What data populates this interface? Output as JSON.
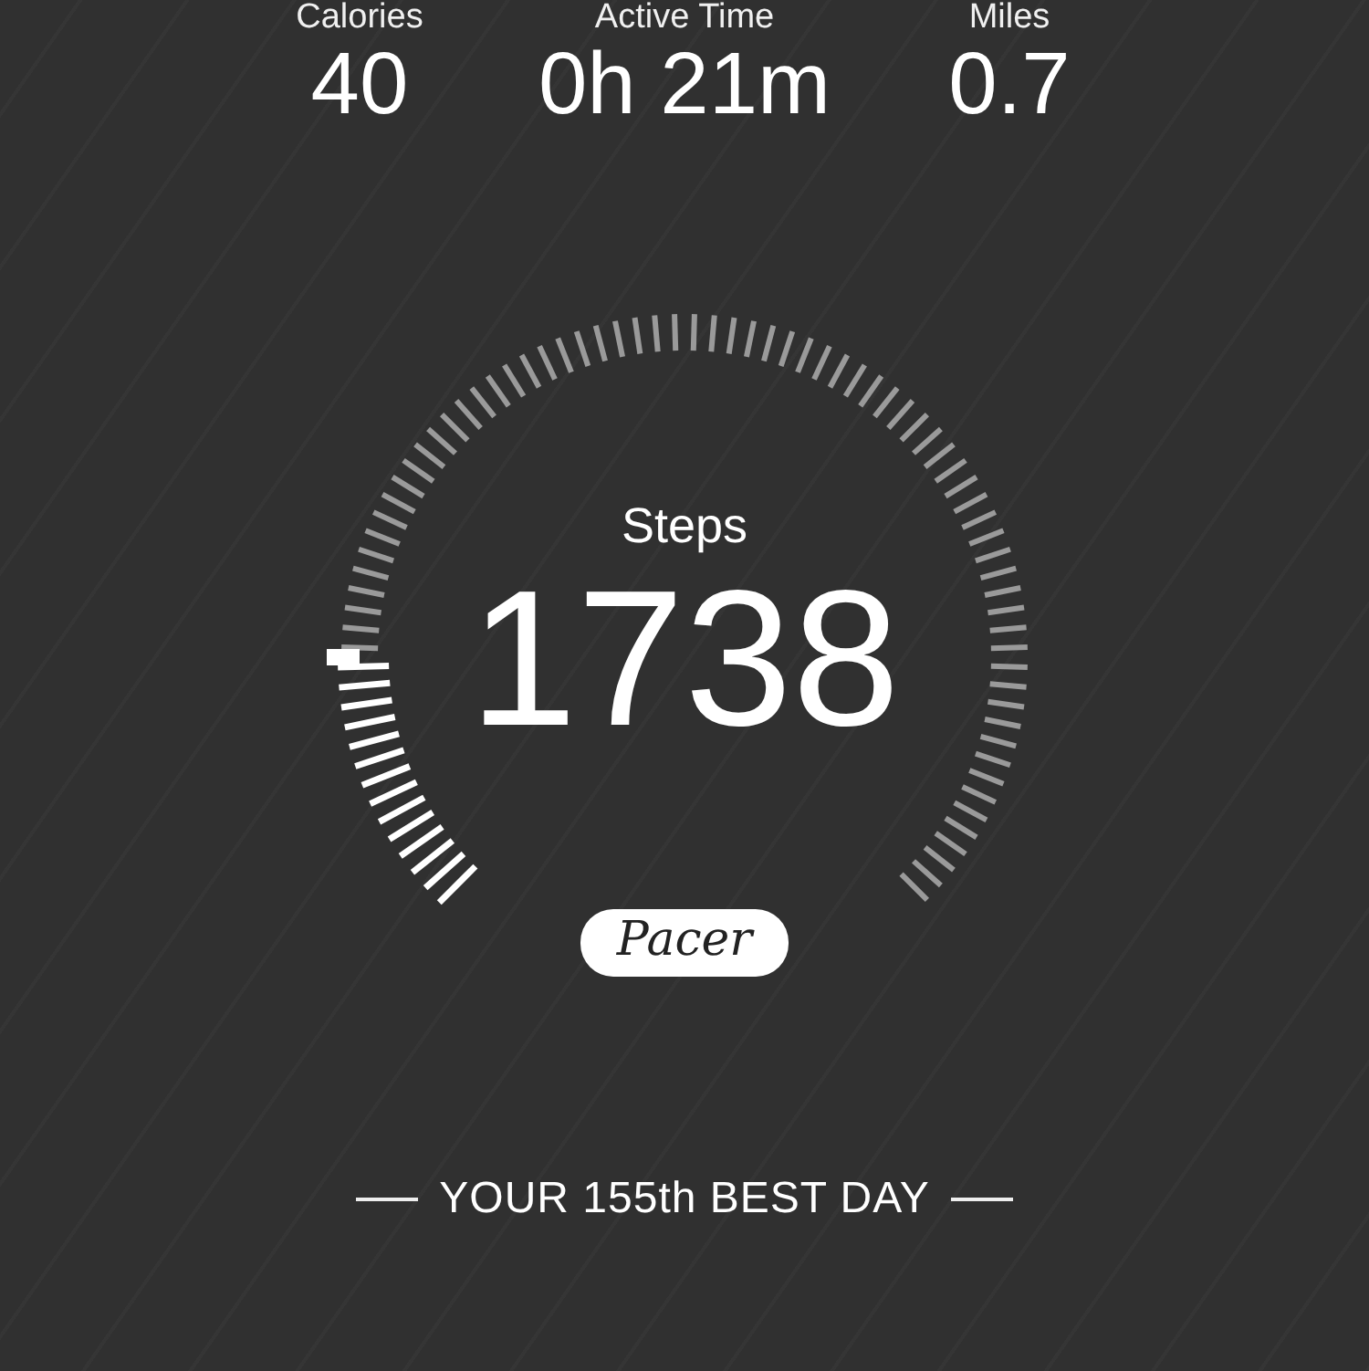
{
  "stats": [
    {
      "label": "Calories",
      "value": "40"
    },
    {
      "label": "Active Time",
      "value": "0h 21m"
    },
    {
      "label": "Miles",
      "value": "0.7"
    }
  ],
  "steps": {
    "label": "Steps",
    "value": "1738"
  },
  "logo": {
    "text": "Pacer"
  },
  "rank": {
    "text": "YOUR 155th BEST DAY"
  }
}
